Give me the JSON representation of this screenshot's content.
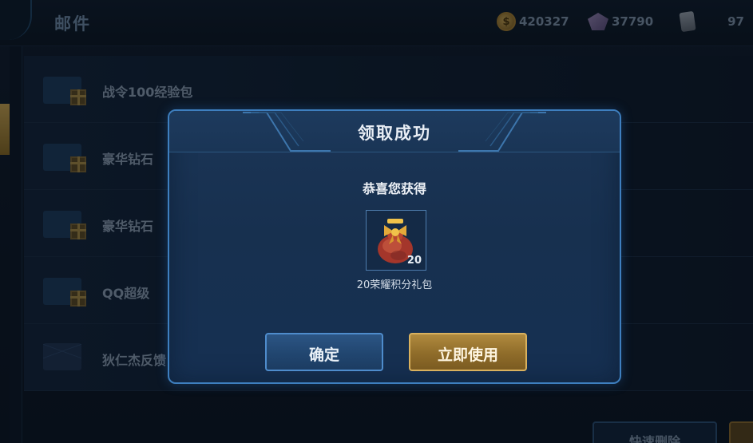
{
  "header": {
    "title": "邮件",
    "resources": {
      "gold": "420327",
      "gems": "37790",
      "cards": "97"
    }
  },
  "mail_list": [
    {
      "subject": "战令100经验包",
      "icon": "gift-icon"
    },
    {
      "subject": "豪华钻石",
      "icon": "gift-icon"
    },
    {
      "subject": "豪华钻石",
      "icon": "gift-icon"
    },
    {
      "subject": "QQ超级",
      "icon": "gift-icon"
    },
    {
      "subject": "狄仁杰反馈：举报成功",
      "icon": "envelope-icon"
    }
  ],
  "bottom": {
    "quick_delete": "快速删除"
  },
  "modal": {
    "title": "领取成功",
    "message": "恭喜您获得",
    "item": {
      "quantity": "20",
      "name": "20荣耀积分礼包",
      "icon": "lucky-bag-icon"
    },
    "confirm_label": "确定",
    "use_label": "立即使用"
  },
  "colors": {
    "modal_border": "#3e7fbf",
    "confirm_border": "#4e8ccc",
    "use_gold": "#d9b15e"
  }
}
